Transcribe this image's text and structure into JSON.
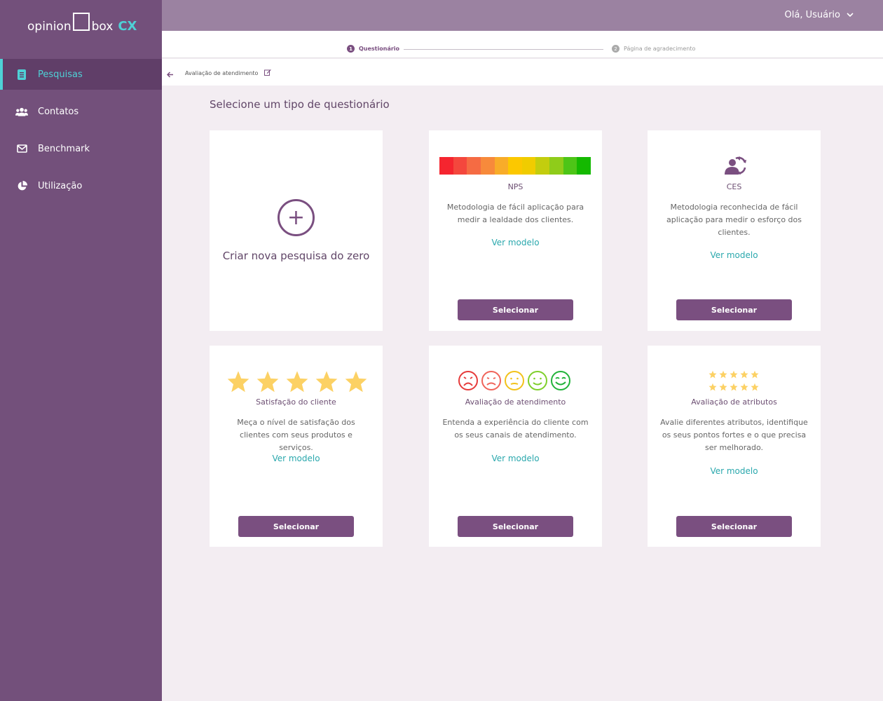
{
  "brand": {
    "opinion": "opinion",
    "box": "box",
    "cx": "CX"
  },
  "user": {
    "greeting": "Olá, Usuário"
  },
  "sidebar": {
    "items": [
      {
        "label": "Pesquisas",
        "icon": "survey-icon",
        "active": true
      },
      {
        "label": "Contatos",
        "icon": "contacts-icon"
      },
      {
        "label": "Benchmark",
        "icon": "mail-icon"
      },
      {
        "label": "Utilização",
        "icon": "pie-chart-icon"
      }
    ]
  },
  "stepper": {
    "steps": [
      {
        "number": "1",
        "label": "Questionário"
      },
      {
        "number": "2",
        "label": "Página de agradecimento"
      }
    ]
  },
  "breadcrumb": {
    "label": "Avaliação de atendimento"
  },
  "page": {
    "title": "Selecione um tipo de questionário"
  },
  "cards": {
    "create": {
      "label": "Criar nova pesquisa do zero"
    },
    "nps": {
      "title": "NPS",
      "desc": "Metodologia de fácil aplicação para medir a lealdade dos clientes.",
      "link": "Ver modelo",
      "button": "Selecionar",
      "scale_colors": [
        "#f5252f",
        "#f4473d",
        "#f56b43",
        "#f78a3b",
        "#f8ac29",
        "#fcc800",
        "#f0cc00",
        "#c3cd0e",
        "#8fcc1a",
        "#4dc517",
        "#14b900"
      ]
    },
    "ces": {
      "title": "CES",
      "desc": "Metodologia reconhecida de fácil aplicação para medir o esforço dos clientes.",
      "link": "Ver modelo",
      "button": "Selecionar"
    },
    "csat": {
      "title": "Satisfação do cliente",
      "desc": "Meça o nível de satisfação dos clientes com seus produtos e serviços.",
      "link": "Ver modelo",
      "button": "Selecionar"
    },
    "service": {
      "title": "Avaliação de atendimento",
      "desc": "Entenda a experiência do cliente com os seus canais de atendimento.",
      "link": "Ver modelo",
      "button": "Selecionar",
      "face_colors": [
        "#e63b3b",
        "#f0645a",
        "#f2c21a",
        "#7fcf2b",
        "#22b33a"
      ]
    },
    "attributes": {
      "title": "Avaliação de atributos",
      "desc": "Avalie diferentes atributos, identifique os seus pontos fortes e o que precisa ser melhorado.",
      "link": "Ver modelo",
      "button": "Selecionar"
    }
  },
  "colors": {
    "accent": "#7a4f80",
    "link": "#2aa8ad",
    "star": "#fcd164",
    "sidebar": "#73507b",
    "active_text": "#4ed1d6"
  }
}
